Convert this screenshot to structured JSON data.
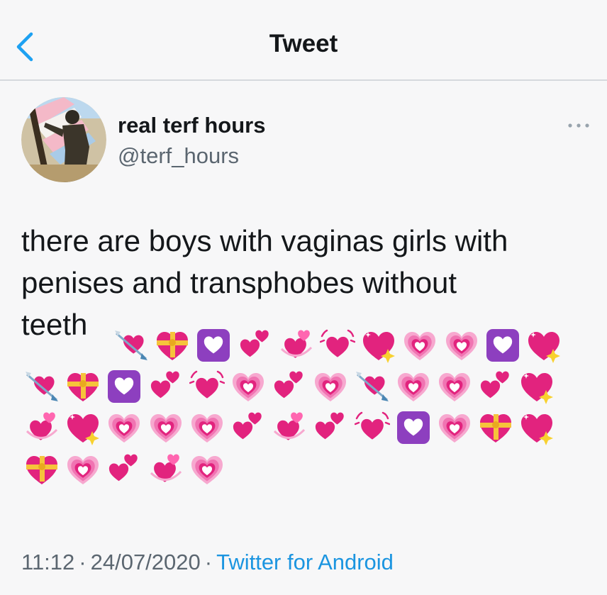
{
  "header": {
    "title": "Tweet",
    "back_icon": "chevron-left-icon",
    "accent_color": "#1da1f2"
  },
  "author": {
    "name": "real terf hours",
    "handle": "@terf_hours",
    "avatar_icon": "profile-photo"
  },
  "more_icon": "more-dots-icon",
  "tweet": {
    "text_line1": "there are boys with vaginas girls with",
    "text_line2": "penises and transphobes without",
    "text_line3": "teeth",
    "emoji_lines": [
      [
        "heart-with-arrow",
        "heart-with-ribbon",
        "white-heart-square",
        "two-hearts",
        "revolving-hearts",
        "beating-heart",
        "sparkling-heart",
        "growing-heart",
        "growing-heart",
        "white-heart-square",
        "sparkling-heart"
      ],
      [
        "heart-with-arrow",
        "heart-with-ribbon",
        "white-heart-square",
        "two-hearts",
        "beating-heart",
        "growing-heart",
        "two-hearts",
        "growing-heart",
        "heart-with-arrow",
        "growing-heart",
        "growing-heart",
        "two-hearts",
        "sparkling-heart"
      ],
      [
        "revolving-hearts",
        "sparkling-heart",
        "growing-heart",
        "growing-heart",
        "growing-heart",
        "two-hearts",
        "revolving-hearts",
        "two-hearts",
        "beating-heart",
        "white-heart-square",
        "growing-heart",
        "heart-with-ribbon",
        "sparkling-heart"
      ],
      [
        "heart-with-ribbon",
        "growing-heart",
        "two-hearts",
        "revolving-hearts",
        "growing-heart"
      ]
    ]
  },
  "meta": {
    "time": "11:12",
    "separator": "·",
    "date": "24/07/2020",
    "source": "Twitter for Android"
  }
}
